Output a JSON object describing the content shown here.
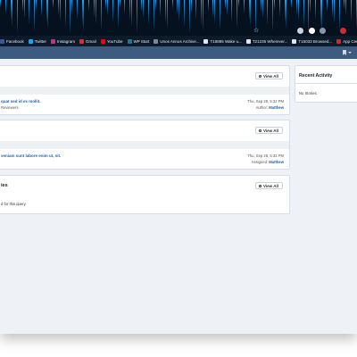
{
  "bookmarks": [
    {
      "label": "Facebook",
      "color": "#3b5998"
    },
    {
      "label": "Twitter",
      "color": "#1da1f2"
    },
    {
      "label": "Instagram",
      "color": "#c13584"
    },
    {
      "label": "Gmail",
      "color": "#d93025"
    },
    {
      "label": "YouTube",
      "color": "#ff0000"
    },
    {
      "label": "WP Start",
      "color": "#21759b"
    },
    {
      "label": "Unos Annos Archive...",
      "color": "#7a8794"
    },
    {
      "label": "T18885 Wake u...",
      "color": "#e0e6ec"
    },
    {
      "label": "T21235 Wherever...",
      "color": "#e0e6ec"
    },
    {
      "label": "T15033 Browsed...",
      "color": "#e0e6ec"
    },
    {
      "label": "App Center",
      "color": "#cc2b2b"
    }
  ],
  "cards": {
    "first": {
      "view_all": "View All",
      "item_title": "quat sed id ex mollit.",
      "item_sub": "Reviewers",
      "item_date": "Thu, Sep 28, 5:32 PM",
      "item_author_label": "Author:",
      "item_author": "Matthew"
    },
    "second": {
      "view_all": "View All",
      "item_title": "veniam sunt labore enim ut, sit.",
      "item_date": "Thu, Sep 28, 5:32 PM",
      "item_assigned_label": "Assigned:",
      "item_assigned": "Matthew"
    },
    "third": {
      "title": "ies",
      "view_all": "View All",
      "empty_text": "d for this query."
    }
  },
  "recent_activity": {
    "title": "Recent Activity",
    "empty_text": "No Stories."
  },
  "colors": {
    "nav": "#3d5a80",
    "link": "#1b63b5",
    "page_bg": "#eef2f6"
  }
}
